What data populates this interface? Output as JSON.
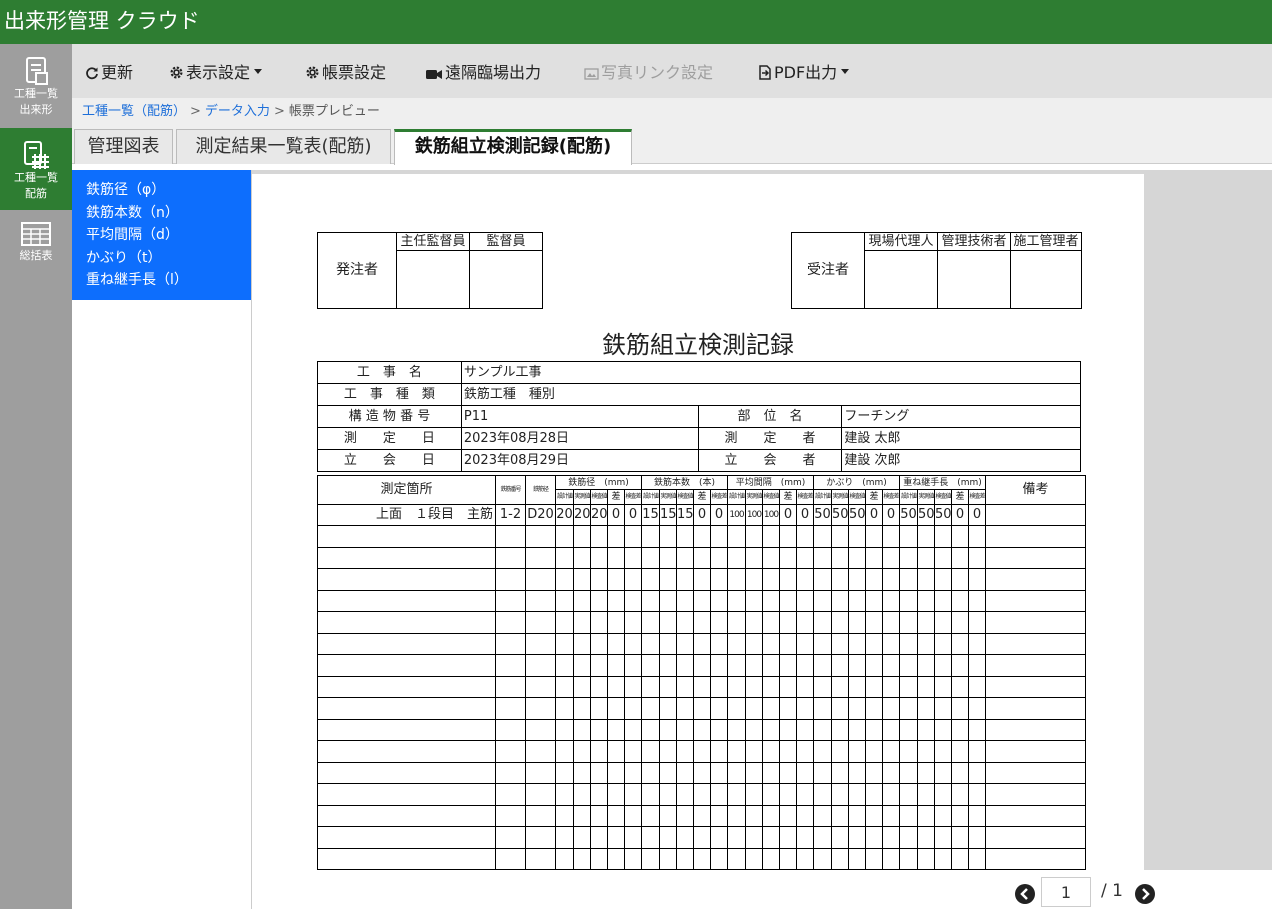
{
  "app": {
    "title": "出来形管理 クラウド"
  },
  "rail": [
    {
      "icon": "document-edit-icon",
      "label1": "工種一覧",
      "label2": "出来形",
      "active": false
    },
    {
      "icon": "grid-document-icon",
      "label1": "工種一覧",
      "label2": "配筋",
      "active": true
    },
    {
      "icon": "table-icon",
      "label1": "総括表",
      "label2": "",
      "active": false
    }
  ],
  "toolbar": {
    "refresh": "更新",
    "display_settings": "表示設定",
    "form_settings": "帳票設定",
    "remote_output": "遠隔臨場出力",
    "photo_link": "写真リンク設定",
    "pdf_output": "PDF出力"
  },
  "breadcrumb": {
    "item1": "工種一覧（配筋）",
    "item2": "データ入力",
    "current": "帳票プレビュー",
    "sep": ">"
  },
  "tabs": [
    "管理図表",
    "測定結果一覧表(配筋)",
    "鉄筋組立検測記録(配筋)"
  ],
  "left_list": [
    "鉄筋径（φ）",
    "鉄筋本数（n）",
    "平均間隔（d）",
    "かぶり（t）",
    "重ね継手長（l）"
  ],
  "form": {
    "orderer": {
      "label": "発注者",
      "cols": [
        "主任監督員",
        "監督員"
      ]
    },
    "contractor": {
      "label": "受注者",
      "cols": [
        "現場代理人",
        "管理技術者",
        "施工管理者"
      ]
    },
    "title": "鉄筋組立検測記録",
    "info": {
      "work_name_label": "工　事　名",
      "work_name": "サンプル工事",
      "work_type_label": "工　事　種　類",
      "work_type": "鉄筋工種　種別",
      "structure_no_label": "構 造 物 番 号",
      "structure_no": "P11",
      "part_label": "部　位　名",
      "part": "フーチング",
      "measure_date_label": "測　　定　　日",
      "measure_date": "2023年08月28日",
      "measurer_label": "測　　定　　者",
      "measurer": "建設 太郎",
      "witness_date_label": "立　　会　　日",
      "witness_date": "2023年08月29日",
      "witness_label": "立　　会　　者",
      "witness": "建設 次郎"
    },
    "meas_headers": {
      "location": "測定箇所",
      "rebar_no": "鉄筋番号",
      "rebar_dia": "鉄筋径",
      "groups": [
        "鉄筋径　(mm)",
        "鉄筋本数　(本)",
        "平均間隔　(mm)",
        "かぶり　(mm)",
        "重ね継手長　(mm)"
      ],
      "sub": [
        "設計値",
        "実測値",
        "検査値",
        "差",
        "検査差"
      ],
      "remarks": "備考"
    },
    "rows": [
      {
        "location": "上面　１段目　主筋",
        "rebar_no": "1-2",
        "rebar_dia": "D20",
        "values": [
          "20",
          "20",
          "20",
          "0",
          "0",
          "15",
          "15",
          "15",
          "0",
          "0",
          "100",
          "100",
          "100",
          "0",
          "0",
          "50",
          "50",
          "50",
          "0",
          "0",
          "50",
          "50",
          "50",
          "0",
          "0"
        ]
      }
    ],
    "empty_rows": 16
  },
  "pager": {
    "current": "1",
    "sep": "/",
    "total": "1"
  }
}
